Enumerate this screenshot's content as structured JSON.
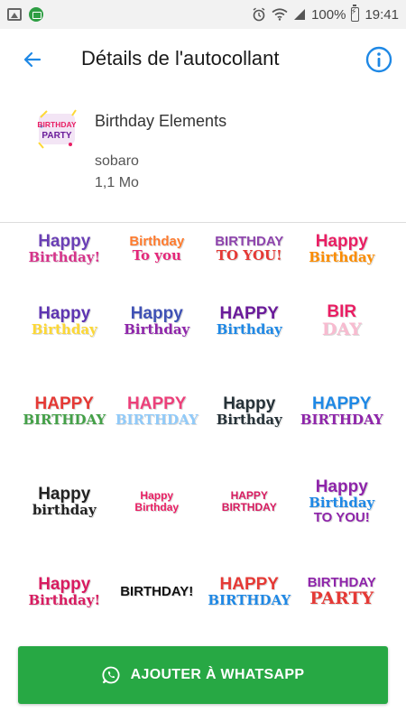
{
  "status_bar": {
    "battery": "100%",
    "time": "19:41",
    "left_icons": [
      "gallery-icon",
      "message-icon"
    ],
    "right_icons": [
      "alarm-icon",
      "wifi-icon",
      "signal-icon",
      "battery-icon"
    ]
  },
  "app_bar": {
    "title": "Détails de l'autocollant",
    "back_icon": "back-arrow-icon",
    "info_icon": "info-icon",
    "accent": "#1e88e5"
  },
  "pack": {
    "name": "Birthday Elements",
    "author": "sobaro",
    "size": "1,1 Mo",
    "tray_lines": [
      "BIRTHDAY",
      "PARTY"
    ]
  },
  "stickers": [
    [
      {
        "lines": [
          "Happy",
          "Birthday!"
        ],
        "colors": [
          "#6a3fb5",
          "#d6338a"
        ]
      },
      {
        "lines": [
          "Birthday",
          "To you"
        ],
        "colors": [
          "#ff7b2e",
          "#e5267a"
        ]
      },
      {
        "lines": [
          "BIRTHDAY",
          "TO YOU!"
        ],
        "colors": [
          "#8e44ad",
          "#e53935"
        ]
      },
      {
        "lines": [
          "Happy",
          "Birthday"
        ],
        "colors": [
          "#e91e63",
          "#fb8c00"
        ]
      }
    ],
    [
      {
        "lines": [
          "Happy",
          "Birthday"
        ],
        "colors": [
          "#5e35b1",
          "#fdd835"
        ]
      },
      {
        "lines": [
          "Happy",
          "Birthday"
        ],
        "colors": [
          "#3f51b5",
          "#8e24aa"
        ]
      },
      {
        "lines": [
          "HAPPY",
          "Birthday"
        ],
        "colors": [
          "#6a1b9a",
          "#1e88e5"
        ]
      },
      {
        "lines": [
          "BIR",
          "DAY"
        ],
        "colors": [
          "#e91e63",
          "#f8bbd0"
        ]
      }
    ],
    [
      {
        "lines": [
          "HAPPY",
          "BIRTHDAY"
        ],
        "colors": [
          "#e53935",
          "#43a047"
        ]
      },
      {
        "lines": [
          "HAPPY",
          "BIRTHDAY"
        ],
        "colors": [
          "#ec407a",
          "#90caf9"
        ]
      },
      {
        "lines": [
          "Happy",
          "Birthday"
        ],
        "colors": [
          "#263238",
          "#263238"
        ]
      },
      {
        "lines": [
          "HAPPY",
          "BIRTHDAY"
        ],
        "colors": [
          "#1e88e5",
          "#8e24aa"
        ]
      }
    ],
    [
      {
        "lines": [
          "Happy",
          "birthday"
        ],
        "colors": [
          "#222222",
          "#222222"
        ]
      },
      {
        "lines": [
          "Happy Birthday"
        ],
        "colors": [
          "#e91e63",
          "#e91e63"
        ]
      },
      {
        "lines": [
          "HAPPY BIRTHDAY"
        ],
        "colors": [
          "#d81b60",
          "#d81b60"
        ]
      },
      {
        "lines": [
          "Happy",
          "Birthday",
          "TO YOU!"
        ],
        "colors": [
          "#8e24aa",
          "#1e88e5"
        ]
      }
    ],
    [
      {
        "lines": [
          "Happy",
          "Birthday!"
        ],
        "colors": [
          "#d81b60",
          "#d81b60"
        ]
      },
      {
        "lines": [
          "BIRTHDAY!"
        ],
        "colors": [
          "#111111",
          "#111111"
        ]
      },
      {
        "lines": [
          "HAPPY",
          "BIRTHDAY"
        ],
        "colors": [
          "#e53935",
          "#1e88e5"
        ]
      },
      {
        "lines": [
          "BIRTHDAY",
          "PARTY"
        ],
        "colors": [
          "#8e24aa",
          "#e53935"
        ]
      }
    ]
  ],
  "add_button": {
    "label": "AJOUTER À WHATSAPP",
    "icon": "whatsapp-icon",
    "color": "#27a844"
  }
}
